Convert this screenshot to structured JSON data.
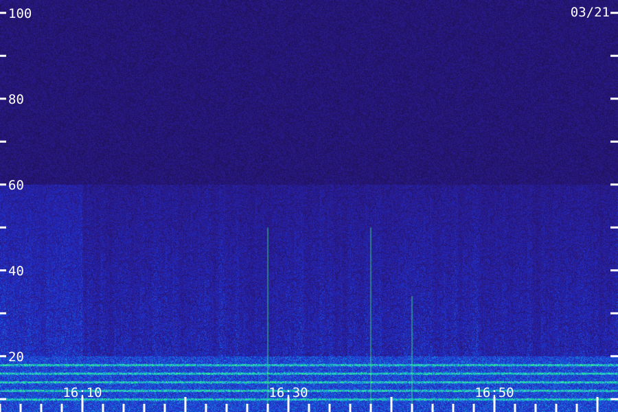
{
  "chart_data": {
    "type": "heatmap",
    "date_label": "03/21",
    "y_tick_labels": [
      "100",
      "80",
      "60",
      "40",
      "20"
    ],
    "y_ticks": [
      100,
      90,
      80,
      70,
      60,
      50,
      40,
      30,
      20,
      10
    ],
    "ylim": [
      7,
      103
    ],
    "x_tick_labels": [
      "16:10",
      "16:30",
      "16:50"
    ],
    "x_range": [
      "16:02",
      "17:02"
    ],
    "x_minor_ticks": [
      "16:02",
      "16:04",
      "16:06",
      "16:08",
      "16:10",
      "16:12",
      "16:14",
      "16:16",
      "16:18",
      "16:20",
      "16:22",
      "16:24",
      "16:26",
      "16:28",
      "16:30",
      "16:32",
      "16:34",
      "16:36",
      "16:38",
      "16:40",
      "16:42",
      "16:44",
      "16:46",
      "16:48",
      "16:50",
      "16:52",
      "16:54",
      "16:56",
      "16:58",
      "17:00"
    ],
    "colormap": [
      "#1a0d40",
      "#2a1a8c",
      "#2030d0",
      "#1a6ee0",
      "#20d0c0",
      "#40ff80"
    ],
    "background_color": "#1a0d40",
    "features": {
      "broadband_region": [
        20,
        60
      ],
      "persistent_bands": [
        18,
        16,
        14,
        12,
        10
      ],
      "vertical_lines": [
        {
          "time": "16:42",
          "top": 34
        },
        {
          "time": "16:38",
          "top": 50
        },
        {
          "time": "16:28",
          "top": 50
        }
      ]
    }
  }
}
